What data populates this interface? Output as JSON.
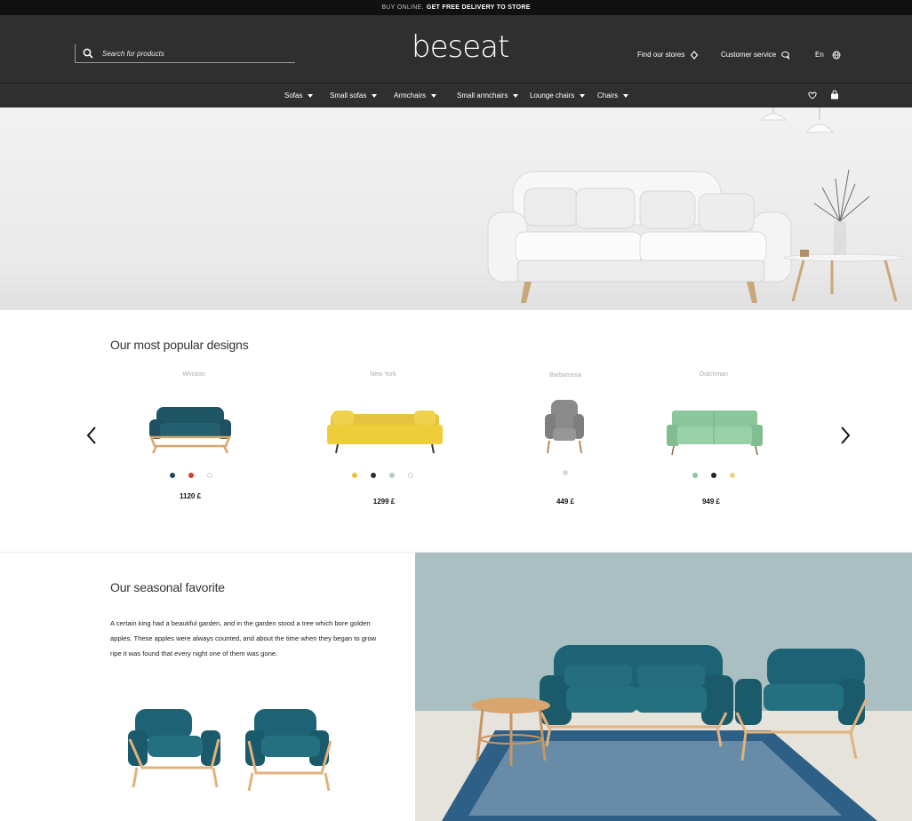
{
  "promo": {
    "prefix": "BUY ONLINE.",
    "highlight": "GET FREE DELIVERY TO STORE"
  },
  "header": {
    "search_placeholder": "Search for products",
    "logo": "beseat",
    "find_stores": "Find our stores",
    "customer_service": "Customer service",
    "language": "En"
  },
  "nav": {
    "items": [
      {
        "label": "Sofas"
      },
      {
        "label": "Small sofas"
      },
      {
        "label": "Armchairs"
      },
      {
        "label": "Small armchairs"
      },
      {
        "label": "Lounge chairs"
      },
      {
        "label": "Chairs"
      }
    ],
    "icons": [
      "heart-icon",
      "shopping-bag-icon"
    ]
  },
  "popular": {
    "title": "Our most popular designs",
    "products": [
      {
        "name": "Winston",
        "price": "1120 £",
        "swatches": [
          "#1f4657",
          "#d33a2c",
          "#ffffff"
        ]
      },
      {
        "name": "New York",
        "price": "1299 £",
        "swatches": [
          "#e6c440",
          "#2a2d33",
          "#b7c8c7",
          "#ffffff"
        ]
      },
      {
        "name": "Barbarossa",
        "price": "449 £",
        "swatches": [
          "#d9d9d9"
        ]
      },
      {
        "name": "Dutchman",
        "price": "949 £",
        "swatches": [
          "#8fc39a",
          "#222222",
          "#e8d08a"
        ]
      }
    ]
  },
  "seasonal": {
    "title": "Our seasonal favorite",
    "text": "A certain king had a beautiful garden, and in the garden stood a tree which bore golden apples. These apples were always counted, and about the time when they began to grow ripe it was found that every night one of them was gone."
  },
  "colors": {
    "header_bg": "#2f2f2f",
    "promo_bg": "#111111",
    "teal": "#1f5a66"
  }
}
